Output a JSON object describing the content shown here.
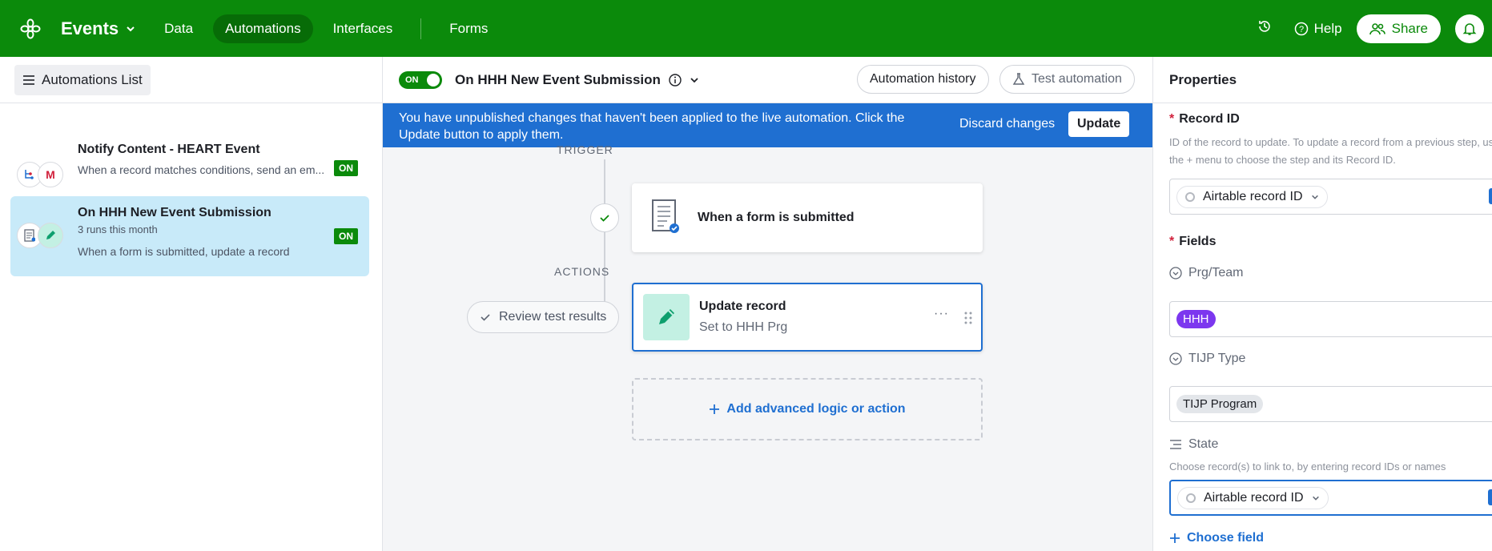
{
  "topbar": {
    "app_title": "Events",
    "nav": [
      "Data",
      "Automations",
      "Interfaces",
      "Forms"
    ],
    "active_nav": "Automations",
    "help_label": "Help",
    "share_label": "Share",
    "colors": {
      "brand": "#0b8a0b",
      "accent": "#1f6fd1"
    }
  },
  "left": {
    "list_button": "Automations List",
    "automations": [
      {
        "title": "Notify Content - HEART Event",
        "runs": "",
        "description": "When a record matches conditions, send an em...",
        "status": "ON"
      },
      {
        "title": "On HHH New Event Submission",
        "runs": "3 runs this month",
        "description": "When a form is submitted, update a record",
        "status": "ON"
      }
    ]
  },
  "center": {
    "toggle_label": "ON",
    "title": "On HHH New Event Submission",
    "history_button": "Automation history",
    "test_button": "Test automation",
    "banner": {
      "text": "You have unpublished changes that haven't been applied to the live automation. Click the Update button to apply them.",
      "discard": "Discard changes",
      "update": "Update"
    },
    "trigger_label": "TRIGGER",
    "trigger_card": "When a form is submitted",
    "actions_label": "ACTIONS",
    "review_button": "Review test results",
    "action_card": {
      "title": "Update record",
      "subtitle": "Set to HHH Prg",
      "menu": "···"
    },
    "add_action": "Add advanced logic or action"
  },
  "right": {
    "header": "Properties",
    "record_id": {
      "label": "Record ID",
      "desc": "ID of the record to update. To update a record from a previous step, use the + menu to choose the step and its Record ID.",
      "value": "Airtable record ID"
    },
    "fields_label": "Fields",
    "fields": [
      {
        "name": "Prg/Team",
        "value": "HHH",
        "tag_color": "#7c37ef"
      },
      {
        "name": "TIJP Type",
        "value": "TIJP Program",
        "tag_color": "#e3e6ea"
      }
    ],
    "state": {
      "name": "State",
      "desc": "Choose record(s) to link to, by entering record IDs or names",
      "value": "Airtable record ID"
    },
    "choose_field": "Choose field"
  }
}
